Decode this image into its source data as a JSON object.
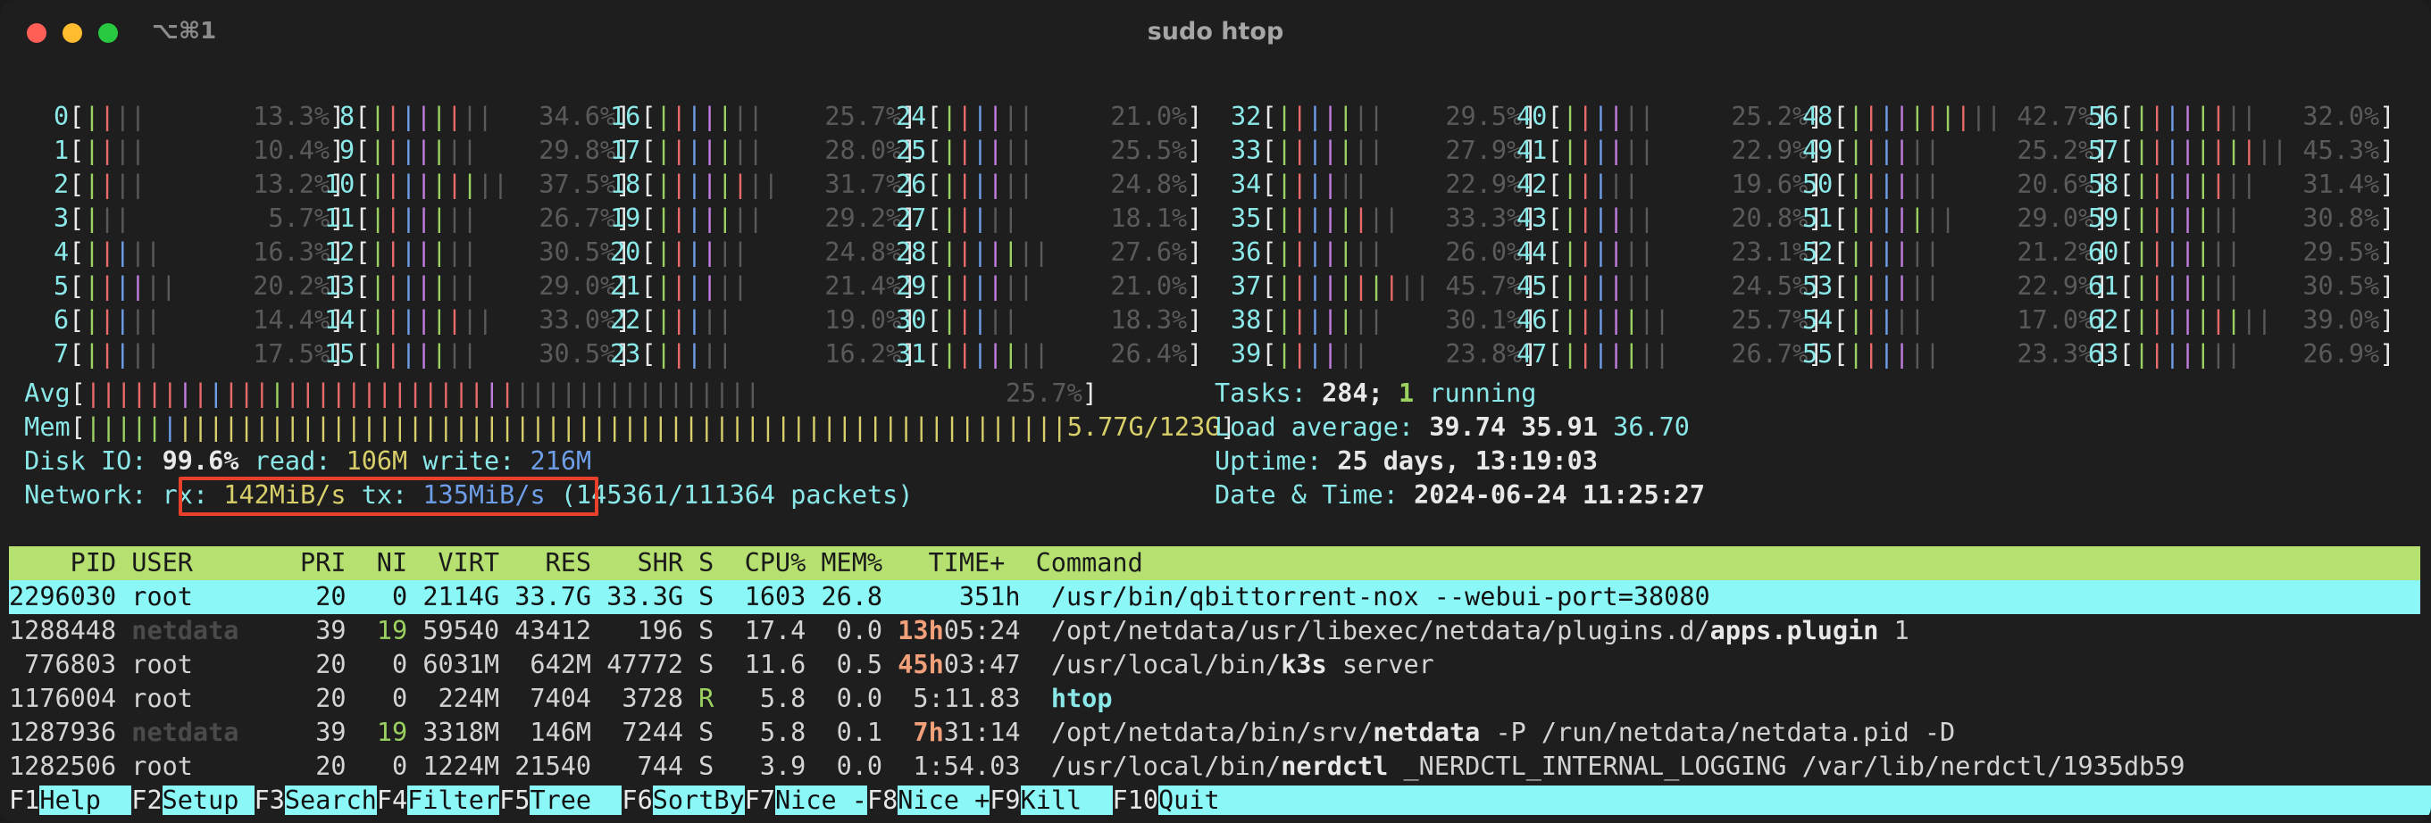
{
  "window": {
    "title": "sudo htop",
    "shortcut": "⌥⌘1"
  },
  "cpus": [
    {
      "id": "0",
      "pct": "13.3%"
    },
    {
      "id": "1",
      "pct": "10.4%"
    },
    {
      "id": "2",
      "pct": "13.2%"
    },
    {
      "id": "3",
      "pct": "5.7%"
    },
    {
      "id": "4",
      "pct": "16.3%"
    },
    {
      "id": "5",
      "pct": "20.2%"
    },
    {
      "id": "6",
      "pct": "14.4%"
    },
    {
      "id": "7",
      "pct": "17.5%"
    },
    {
      "id": "8",
      "pct": "34.6%"
    },
    {
      "id": "9",
      "pct": "29.8%"
    },
    {
      "id": "10",
      "pct": "37.5%"
    },
    {
      "id": "11",
      "pct": "26.7%"
    },
    {
      "id": "12",
      "pct": "30.5%"
    },
    {
      "id": "13",
      "pct": "29.0%"
    },
    {
      "id": "14",
      "pct": "33.0%"
    },
    {
      "id": "15",
      "pct": "30.5%"
    },
    {
      "id": "16",
      "pct": "25.7%"
    },
    {
      "id": "17",
      "pct": "28.0%"
    },
    {
      "id": "18",
      "pct": "31.7%"
    },
    {
      "id": "19",
      "pct": "29.2%"
    },
    {
      "id": "20",
      "pct": "24.8%"
    },
    {
      "id": "21",
      "pct": "21.4%"
    },
    {
      "id": "22",
      "pct": "19.0%"
    },
    {
      "id": "23",
      "pct": "16.2%"
    },
    {
      "id": "24",
      "pct": "21.0%"
    },
    {
      "id": "25",
      "pct": "25.5%"
    },
    {
      "id": "26",
      "pct": "24.8%"
    },
    {
      "id": "27",
      "pct": "18.1%"
    },
    {
      "id": "28",
      "pct": "27.6%"
    },
    {
      "id": "29",
      "pct": "21.0%"
    },
    {
      "id": "30",
      "pct": "18.3%"
    },
    {
      "id": "31",
      "pct": "26.4%"
    },
    {
      "id": "32",
      "pct": "29.5%"
    },
    {
      "id": "33",
      "pct": "27.9%"
    },
    {
      "id": "34",
      "pct": "22.9%"
    },
    {
      "id": "35",
      "pct": "33.3%"
    },
    {
      "id": "36",
      "pct": "26.0%"
    },
    {
      "id": "37",
      "pct": "45.7%"
    },
    {
      "id": "38",
      "pct": "30.1%"
    },
    {
      "id": "39",
      "pct": "23.8%"
    },
    {
      "id": "40",
      "pct": "25.2%"
    },
    {
      "id": "41",
      "pct": "22.9%"
    },
    {
      "id": "42",
      "pct": "19.6%"
    },
    {
      "id": "43",
      "pct": "20.8%"
    },
    {
      "id": "44",
      "pct": "23.1%"
    },
    {
      "id": "45",
      "pct": "24.5%"
    },
    {
      "id": "46",
      "pct": "25.7%"
    },
    {
      "id": "47",
      "pct": "26.7%"
    },
    {
      "id": "48",
      "pct": "42.7%"
    },
    {
      "id": "49",
      "pct": "25.2%"
    },
    {
      "id": "50",
      "pct": "20.6%"
    },
    {
      "id": "51",
      "pct": "29.0%"
    },
    {
      "id": "52",
      "pct": "21.2%"
    },
    {
      "id": "53",
      "pct": "22.9%"
    },
    {
      "id": "54",
      "pct": "17.0%"
    },
    {
      "id": "55",
      "pct": "23.3%"
    },
    {
      "id": "56",
      "pct": "32.0%"
    },
    {
      "id": "57",
      "pct": "45.3%"
    },
    {
      "id": "58",
      "pct": "31.4%"
    },
    {
      "id": "59",
      "pct": "30.8%"
    },
    {
      "id": "60",
      "pct": "29.5%"
    },
    {
      "id": "61",
      "pct": "30.5%"
    },
    {
      "id": "62",
      "pct": "39.0%"
    },
    {
      "id": "63",
      "pct": "26.9%"
    }
  ],
  "meters": {
    "avg_label": "Avg",
    "avg_pct": "25.7%",
    "mem_label": "Mem",
    "mem_value": "5.77G/123G",
    "disk_label": "Disk IO:",
    "disk_pct": "99.6%",
    "disk_read_label": "read:",
    "disk_read": "106M",
    "disk_write_label": "write:",
    "disk_write": "216M",
    "net_label": "Network:",
    "net_rx_label": "rx:",
    "net_rx": "142MiB/s",
    "net_tx_label": "tx:",
    "net_tx": "135MiB/s",
    "net_packets": "(145361/111364 packets)"
  },
  "stats": {
    "tasks_label": "Tasks:",
    "tasks_count": "284;",
    "running_count": "1",
    "running_label": "running",
    "load_label": "Load average:",
    "load_1": "39.74",
    "load_5": "35.91",
    "load_15": "36.70",
    "uptime_label": "Uptime:",
    "uptime_value": "25 days, 13:19:03",
    "datetime_label": "Date & Time:",
    "datetime_value": "2024-06-24 11:25:27"
  },
  "table": {
    "header": "    PID USER       PRI  NI  VIRT   RES   SHR S  CPU% MEM%   TIME+  Command",
    "rows": [
      {
        "pid": "2296030",
        "user": "root",
        "pri": "20",
        "ni": "0",
        "virt": "2114G",
        "res": "33.7G",
        "shr": "33.3G",
        "s": "S",
        "cpu": "1603",
        "mem": "26.8",
        "time": "351h",
        "cmd": "/usr/bin/qbittorrent-nox --webui-port=38080"
      },
      {
        "pid": "1288448",
        "user": "netdata",
        "pri": "39",
        "ni": "19",
        "virt": "59540",
        "res": "43412",
        "shr": "196",
        "s": "S",
        "cpu": "17.4",
        "mem": "0.0",
        "time_h": "13h",
        "time": "05:24",
        "cmd_path": "/opt/netdata/usr/libexec/netdata/plugins.d/",
        "cmd_bin": "apps.plugin",
        "cmd_args": " 1"
      },
      {
        "pid": "776803",
        "user": "root",
        "pri": "20",
        "ni": "0",
        "virt": "6031M",
        "res": "642M",
        "shr": "47772",
        "s": "S",
        "cpu": "11.6",
        "mem": "0.5",
        "time_h": "45h",
        "time": "03:47",
        "cmd_path": "/usr/local/bin/",
        "cmd_bin": "k3s",
        "cmd_args": " server"
      },
      {
        "pid": "1176004",
        "user": "root",
        "pri": "20",
        "ni": "0",
        "virt": "224M",
        "res": "7404",
        "shr": "3728",
        "s": "R",
        "cpu": "5.8",
        "mem": "0.0",
        "time": "5:11.83",
        "cmd_bin": "htop"
      },
      {
        "pid": "1287936",
        "user": "netdata",
        "pri": "39",
        "ni": "19",
        "virt": "3318M",
        "res": "146M",
        "shr": "7244",
        "s": "S",
        "cpu": "5.8",
        "mem": "0.1",
        "time_h": "7h",
        "time": "31:14",
        "cmd_path": "/opt/netdata/bin/srv/",
        "cmd_bin": "netdata",
        "cmd_args": " -P /run/netdata/netdata.pid -D"
      },
      {
        "pid": "1282506",
        "user": "root",
        "pri": "20",
        "ni": "0",
        "virt": "1224M",
        "res": "21540",
        "shr": "744",
        "s": "S",
        "cpu": "3.9",
        "mem": "0.0",
        "time": "1:54.03",
        "cmd_path": "/usr/local/bin/",
        "cmd_bin": "nerdctl",
        "cmd_args": " _NERDCTL_INTERNAL_LOGGING /var/lib/nerdctl/1935db59"
      }
    ]
  },
  "fkeys": [
    {
      "key": "F1",
      "label": "Help  "
    },
    {
      "key": "F2",
      "label": "Setup "
    },
    {
      "key": "F3",
      "label": "Search"
    },
    {
      "key": "F4",
      "label": "Filter"
    },
    {
      "key": "F5",
      "label": "Tree  "
    },
    {
      "key": "F6",
      "label": "SortBy"
    },
    {
      "key": "F7",
      "label": "Nice -"
    },
    {
      "key": "F8",
      "label": "Nice +"
    },
    {
      "key": "F9",
      "label": "Kill  "
    },
    {
      "key": "F10",
      "label": "Quit"
    }
  ],
  "colors": {
    "header_bg": "#b6e171",
    "selection_bg": "#8bf7f7",
    "highlight_box": "#e8402a"
  }
}
